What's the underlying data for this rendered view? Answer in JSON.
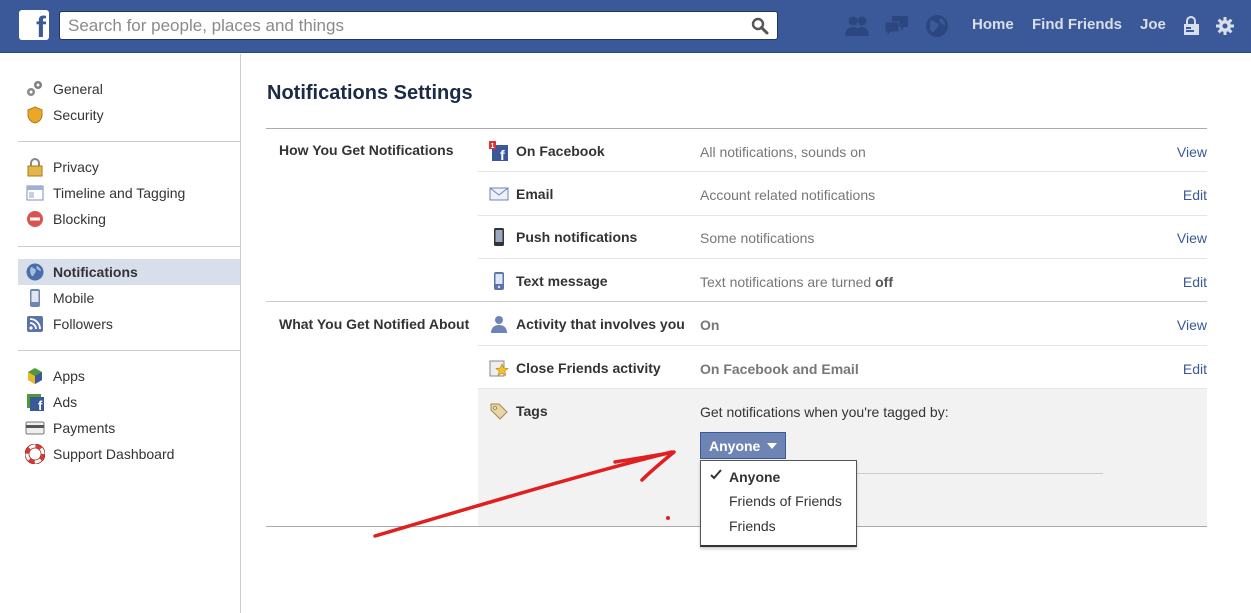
{
  "topbar": {
    "logo": "f",
    "search_placeholder": "Search for people, places and things",
    "nav": [
      "Home",
      "Find Friends",
      "Joe"
    ]
  },
  "sidebar": {
    "groups": [
      [
        {
          "label": "General",
          "icon": "gears-icon"
        },
        {
          "label": "Security",
          "icon": "shield-icon"
        }
      ],
      [
        {
          "label": "Privacy",
          "icon": "lock-icon"
        },
        {
          "label": "Timeline and Tagging",
          "icon": "timeline-icon"
        },
        {
          "label": "Blocking",
          "icon": "blocking-icon"
        }
      ],
      [
        {
          "label": "Notifications",
          "icon": "globe-icon",
          "active": true
        },
        {
          "label": "Mobile",
          "icon": "mobile-phone-icon"
        },
        {
          "label": "Followers",
          "icon": "rss-icon"
        }
      ],
      [
        {
          "label": "Apps",
          "icon": "apps-cube-icon"
        },
        {
          "label": "Ads",
          "icon": "ads-icon"
        },
        {
          "label": "Payments",
          "icon": "credit-card-icon"
        },
        {
          "label": "Support Dashboard",
          "icon": "lifebuoy-icon"
        }
      ]
    ]
  },
  "main": {
    "title": "Notifications Settings",
    "sections": [
      {
        "label": "How You Get Notifications",
        "rows": [
          {
            "name": "On Facebook",
            "status": "All notifications, sounds on",
            "action": "View",
            "icon": "facebook-notification-icon"
          },
          {
            "name": "Email",
            "status": "Account related notifications",
            "action": "Edit",
            "icon": "envelope-icon"
          },
          {
            "name": "Push notifications",
            "status": "Some notifications",
            "action": "View",
            "icon": "smartphone-icon"
          },
          {
            "name": "Text message",
            "status_prefix": "Text notifications are turned ",
            "status_bold": "off",
            "action": "Edit",
            "icon": "phone-icon"
          }
        ]
      },
      {
        "label": "What You Get Notified About",
        "rows": [
          {
            "name": "Activity that involves you",
            "status": "On",
            "action": "View",
            "icon": "person-icon"
          },
          {
            "name": "Close Friends activity",
            "status": "On Facebook and Email",
            "action": "Edit",
            "icon": "star-icon"
          },
          {
            "name": "Tags",
            "prompt": "Get notifications when you're tagged by:",
            "icon": "tag-icon"
          }
        ]
      }
    ],
    "tags_dropdown": {
      "selected": "Anyone",
      "options": [
        "Anyone",
        "Friends of Friends",
        "Friends"
      ]
    }
  },
  "colors": {
    "brand": "#3b5998",
    "dropdown": "#6d84b4",
    "annotation_arrow": "#e02020"
  }
}
